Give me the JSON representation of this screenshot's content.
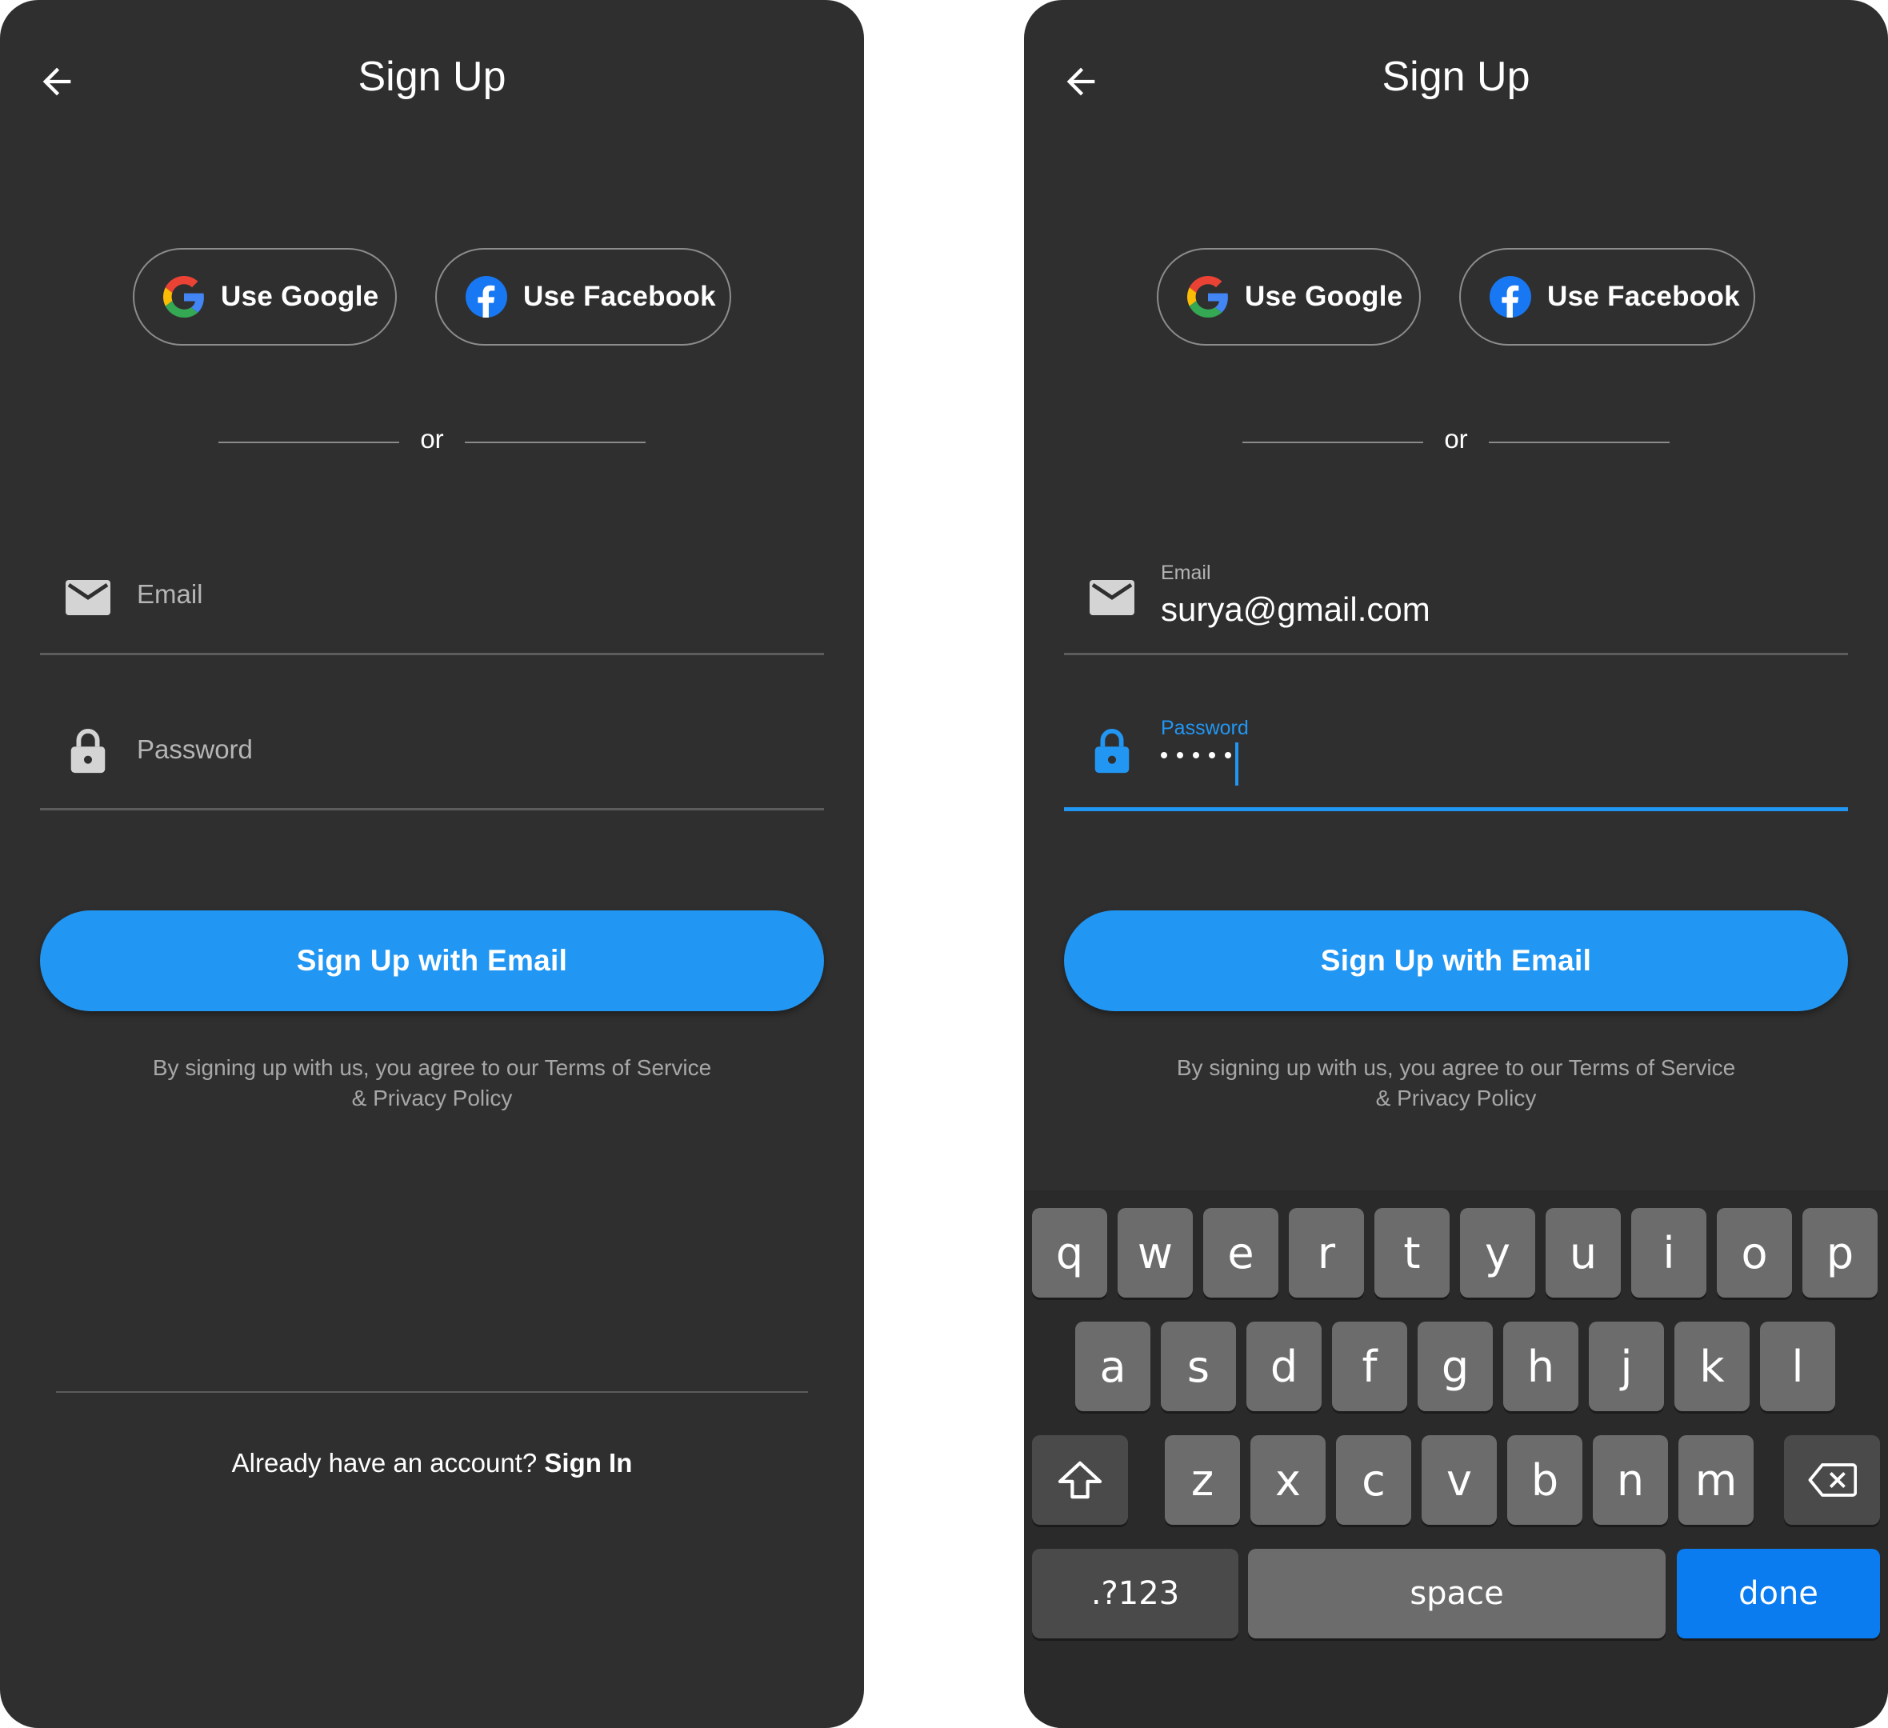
{
  "screens": [
    {
      "id": "signup-empty",
      "title": "Sign Up",
      "social": {
        "google": "Use Google",
        "facebook": "Use Facebook"
      },
      "divider_text": "or",
      "email": {
        "placeholder": "Email",
        "value": ""
      },
      "password": {
        "placeholder": "Password",
        "value": ""
      },
      "cta": "Sign Up with Email",
      "terms": "By signing up with us, you agree to our Terms of Service & Privacy Policy",
      "footer": {
        "prompt": "Already have an account?",
        "link": "Sign In"
      }
    },
    {
      "id": "signup-filled",
      "title": "Sign Up",
      "social": {
        "google": "Use Google",
        "facebook": "Use Facebook"
      },
      "divider_text": "or",
      "email": {
        "label": "Email",
        "value": "surya@gmail.com"
      },
      "password": {
        "label": "Password",
        "masked_length": 5,
        "focused": true
      },
      "cta": "Sign Up with Email",
      "terms": "By signing up with us, you agree to our Terms of Service & Privacy Policy",
      "keyboard": {
        "row1": [
          "q",
          "w",
          "e",
          "r",
          "t",
          "y",
          "u",
          "i",
          "o",
          "p"
        ],
        "row2": [
          "a",
          "s",
          "d",
          "f",
          "g",
          "h",
          "j",
          "k",
          "l"
        ],
        "row3": [
          "z",
          "x",
          "c",
          "v",
          "b",
          "n",
          "m"
        ],
        "row4": {
          "symbols": ".?123",
          "space": "space",
          "done": "done"
        },
        "shift_icon": "shift-icon",
        "backspace_icon": "backspace-icon"
      }
    }
  ],
  "colors": {
    "background": "#2f2f2f",
    "accent": "#2196f3",
    "done_key": "#0a7cf0",
    "key": "#6c6c6c",
    "key_dark": "#4a4a4a"
  }
}
